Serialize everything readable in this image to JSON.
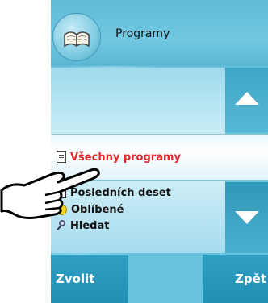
{
  "header": {
    "title": "Programy",
    "icon": "book-icon"
  },
  "list": {
    "items": [
      {
        "label": "Všechny programy",
        "icon": "document-icon",
        "selected": true
      },
      {
        "label": "Posledních deset",
        "icon": "dice-icon",
        "selected": false
      },
      {
        "label": "Oblíbené",
        "icon": "smiley-icon",
        "selected": false
      },
      {
        "label": "Hledat",
        "icon": "magnifier-icon",
        "selected": false
      }
    ]
  },
  "buttons": {
    "select_label": "Zvolit",
    "back_label": "Zpět"
  },
  "colors": {
    "screen_bg": "#67c2dd",
    "button_bg": "#2fa0c3",
    "selected_text": "#e2272b"
  }
}
